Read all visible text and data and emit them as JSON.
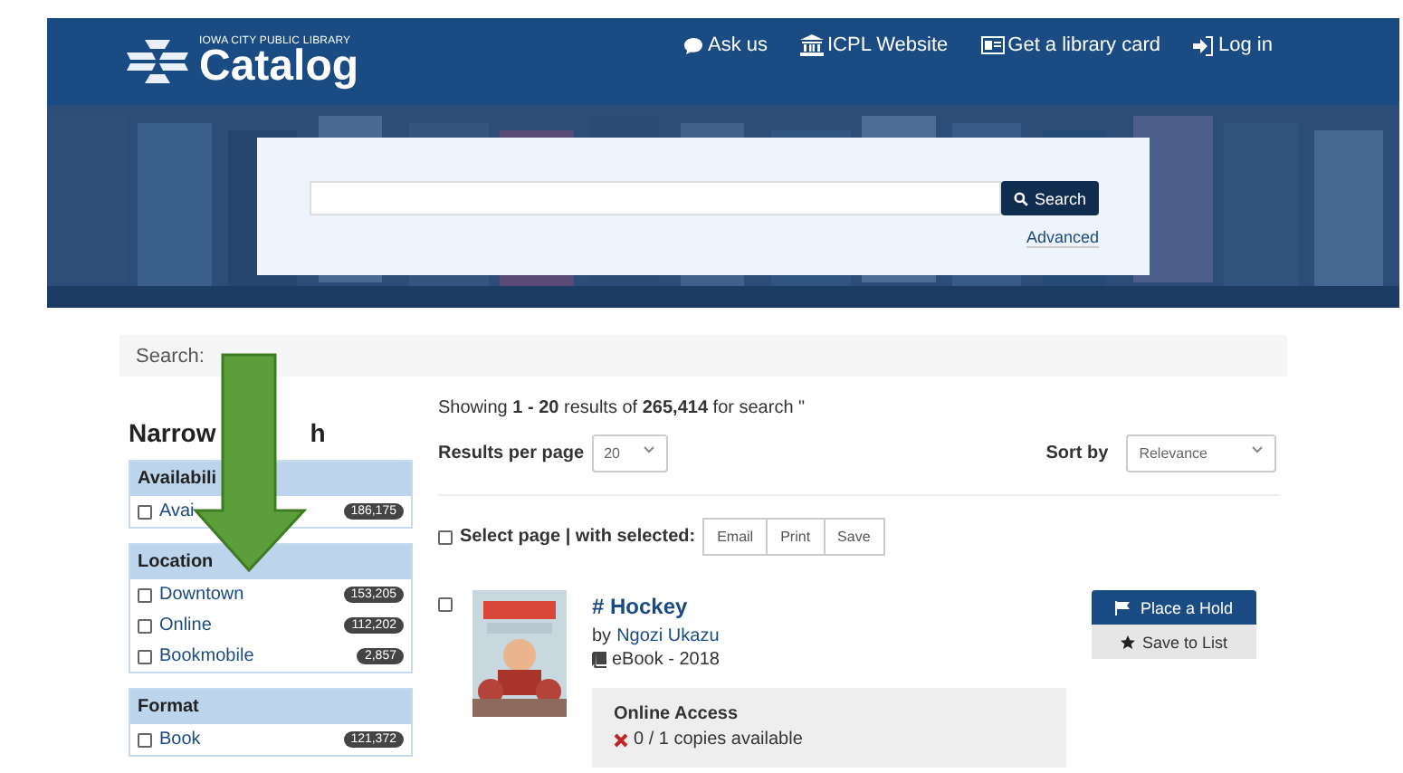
{
  "header": {
    "logo_small": "IOWA CITY PUBLIC LIBRARY",
    "logo": "Catalog",
    "nav": [
      {
        "kind": "chat",
        "label": "Ask us"
      },
      {
        "kind": "building",
        "label": "ICPL Website"
      },
      {
        "kind": "card",
        "label": "Get a library card"
      },
      {
        "kind": "login",
        "label": "Log in"
      }
    ]
  },
  "search_box": {
    "button": "Search",
    "advanced": "Advanced"
  },
  "breadcrumb": "Search:",
  "sidebar": {
    "heading_parts": [
      "Narrow",
      "h"
    ],
    "groups": [
      {
        "title": "Availabili",
        "items": [
          {
            "label": "Avai",
            "count": "186,175",
            "checked": false
          }
        ]
      },
      {
        "title": "Location",
        "items": [
          {
            "label": "Downtown",
            "count": "153,205",
            "checked": false
          },
          {
            "label": "Online",
            "count": "112,202",
            "checked": false
          },
          {
            "label": "Bookmobile",
            "count": "2,857",
            "checked": false
          }
        ]
      },
      {
        "title": "Format",
        "items": [
          {
            "label": "Book",
            "count": "121,372",
            "checked": false
          }
        ]
      }
    ]
  },
  "results": {
    "summary": "Showing **1 - 20** results of **265,414** for search \"",
    "per_page_label": "Results per page",
    "per_page": "20",
    "sort_label": "Sort by",
    "sort": "Relevance",
    "select_page": {
      "label": "Select page | with selected:",
      "checked": false
    },
    "actions": [
      "Email",
      "Print",
      "Save"
    ],
    "items": [
      {
        "checked": false,
        "title": "# Hockey",
        "by": "by",
        "author": "Ngozi Ukazu",
        "format": "eBook - 2018",
        "access_title": "Online Access",
        "availability": "0 / 1 copies available",
        "hold": "Place a Hold",
        "save": "Save to List"
      }
    ]
  }
}
